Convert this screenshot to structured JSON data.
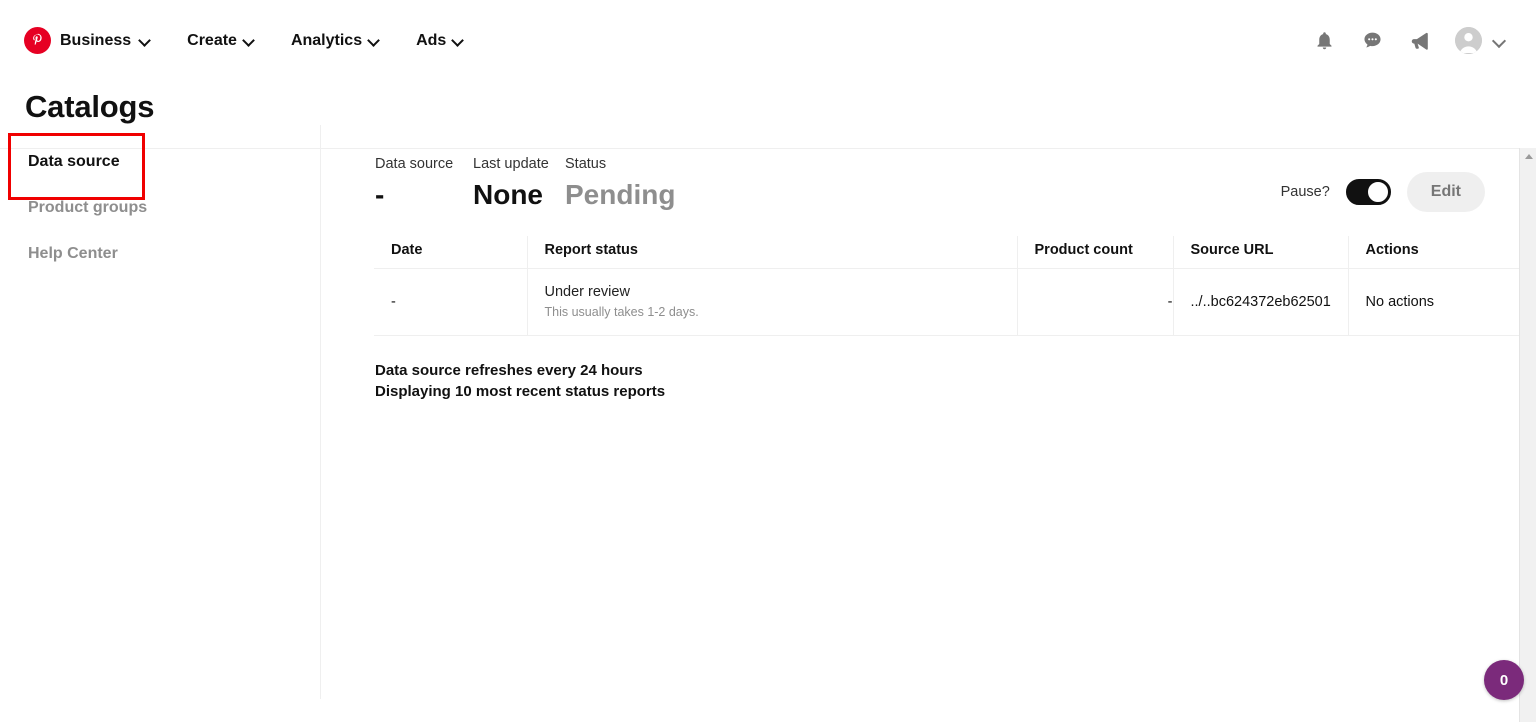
{
  "topnav": {
    "brand": {
      "label": "Business",
      "icon": "pinterest-logo"
    },
    "items": [
      {
        "label": "Create",
        "icon": "chevron-down-icon"
      },
      {
        "label": "Analytics",
        "icon": "chevron-down-icon"
      },
      {
        "label": "Ads",
        "icon": "chevron-down-icon"
      }
    ],
    "right_icons": [
      {
        "name": "notifications-bell-icon"
      },
      {
        "name": "messages-chat-icon"
      },
      {
        "name": "announcements-megaphone-icon"
      },
      {
        "name": "avatar"
      },
      {
        "name": "chevron-down-icon"
      }
    ]
  },
  "page": {
    "title": "Catalogs"
  },
  "sidebar": {
    "items": [
      {
        "label": "Data source",
        "active": true
      },
      {
        "label": "Product groups",
        "active": false
      },
      {
        "label": "Help Center",
        "active": false
      }
    ]
  },
  "summary": {
    "data_source": {
      "label": "Data source",
      "value": "-"
    },
    "last_update": {
      "label": "Last update",
      "value": "None"
    },
    "status": {
      "label": "Status",
      "value": "Pending"
    },
    "pause_label": "Pause?",
    "pause_state": "on",
    "edit_label": "Edit"
  },
  "table": {
    "headers": [
      "Date",
      "Report status",
      "Product count",
      "Source URL",
      "Actions"
    ],
    "rows": [
      {
        "date": "-",
        "report_status": "Under review",
        "report_note": "This usually takes 1-2 days.",
        "product_count": "-",
        "source_url": "../..bc624372eb62501",
        "actions": "No actions"
      }
    ]
  },
  "footnotes": {
    "line1": "Data source refreshes every 24 hours",
    "line2": "Displaying 10 most recent status reports"
  },
  "floating_badge": {
    "count": "0"
  },
  "colors": {
    "brand_red": "#e60023",
    "highlight_red": "#f00000",
    "badge_purple": "#7b2a7b",
    "muted_text": "#8e8e8e"
  }
}
